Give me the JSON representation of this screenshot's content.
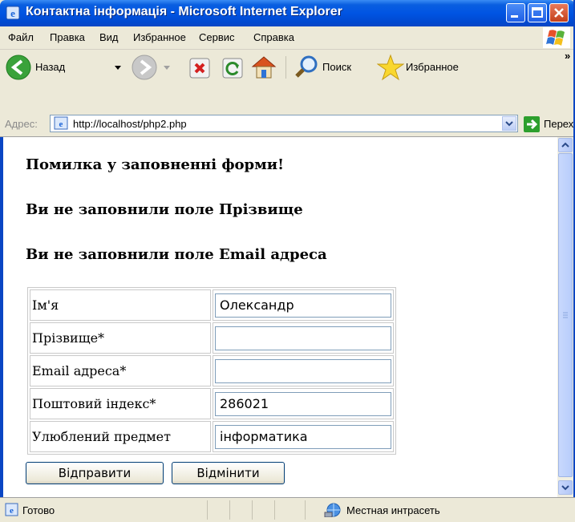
{
  "window": {
    "title": "Контактна інформація - Microsoft Internet Explorer"
  },
  "menu": {
    "items": [
      "Файл",
      "Правка",
      "Вид",
      "Избранное",
      "Сервис",
      "Справка"
    ]
  },
  "toolbar": {
    "back_label": "Назад",
    "search_label": "Поиск",
    "favorites_label": "Избранное",
    "overflow": "»"
  },
  "address": {
    "label": "Адрес:",
    "url": "http://localhost/php2.php",
    "go_label": "Переход"
  },
  "page": {
    "errors": [
      "Помилка у заповненні форми!",
      "Ви не заповнили поле Прізвище",
      "Ви не заповнили поле Email адреса"
    ],
    "form": {
      "rows": [
        {
          "label": "Ім'я",
          "value": ""
        },
        {
          "label": "Прізвище*",
          "value": ""
        },
        {
          "label": "Email адреса*",
          "value": ""
        },
        {
          "label": "Поштовий індекс*",
          "value": ""
        },
        {
          "label": "Улюблений предмет",
          "value": ""
        }
      ],
      "values": [
        "Олександр",
        "",
        "",
        "286021",
        "інформатика"
      ],
      "submit_label": "Відправити",
      "reset_label": "Відмінити"
    }
  },
  "status": {
    "text": "Готово",
    "zone": "Местная интрасеть"
  },
  "colors": {
    "titlebar": "#0054e3",
    "chrome": "#ece9d8",
    "field_border": "#7f9db9"
  }
}
